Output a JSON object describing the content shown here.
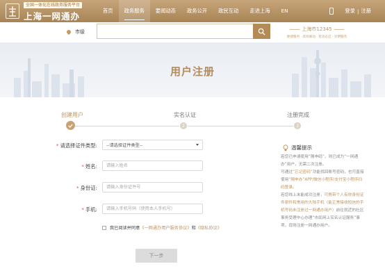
{
  "header": {
    "logo_sub": "全国一体化在线政务服务平台",
    "logo_main": "上海一网通办",
    "nav": [
      "首页",
      "政务服务",
      "要闻动态",
      "政务公开",
      "政民互动",
      "走进上海",
      "EN"
    ],
    "login": "登录",
    "separator": "|",
    "register": "注册"
  },
  "search": {
    "location": "市级",
    "placeholder": ""
  },
  "hotline": {
    "title": "上海市12345",
    "sub": "便捷服务 · 高效联动 · 有诉必应 · 文明服务"
  },
  "banner": {
    "title": "用户注册"
  },
  "steps": [
    {
      "label": "创建用户",
      "state": "active"
    },
    {
      "label": "实名认证",
      "state": "idle"
    },
    {
      "label": "注册完成",
      "state": "idle"
    }
  ],
  "form": {
    "doc_type": {
      "label": "请选择证件类型:",
      "value": "--请选择证件类型--"
    },
    "name": {
      "label": "姓名:",
      "placeholder": "请输入姓名"
    },
    "id_number": {
      "label": "身份证:",
      "placeholder": "请输入身份证件号"
    },
    "phone": {
      "label": "手机:",
      "placeholder": "请输入手机号码（使用本人手机号）"
    },
    "agree_prefix": "我已阅读并同意",
    "agree_link1": "《一网通办用户服务协议》",
    "agree_and": "和",
    "agree_link2": "《隐私协议》",
    "next": "下一步"
  },
  "tips": {
    "title": "温馨提示",
    "p1": "若您已申请使用“随申码”，则已成为“一网通办”用户，无需二次注册。",
    "p2_a": "可通过",
    "p2_hl": "“忘记密码”",
    "p2_b": "功能找回账号密码，也可直接使用",
    "p2_hl2": "“随申办”APP/微信小程序/支付宝小程序扫码登录。",
    "p3_a": "若您线上未能成功注册，",
    "p3_hl": "可携带个人有效身份证件原件和常用的大陆手机（能正常接收短信的手机号码未注册过一网通办用户）",
    "p3_b": "前往就近的社区事务受理中心办理“市民网上实名认证服务”事项，现场注册一网通办用户。"
  },
  "colors": {
    "brand": "#b48a57",
    "accent": "#c0955f"
  }
}
